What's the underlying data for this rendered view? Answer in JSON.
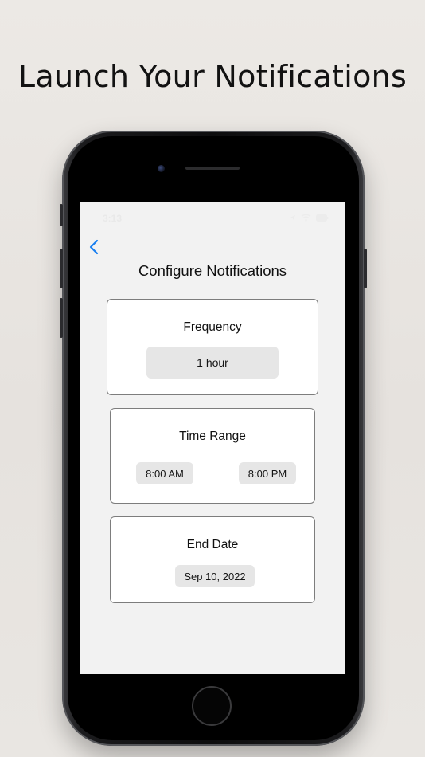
{
  "headline": "Launch Your Notifications",
  "status_bar": {
    "time": "3:13"
  },
  "nav": {
    "back_icon": "chevron-left-icon",
    "title": "Configure Notifications"
  },
  "frequency": {
    "title": "Frequency",
    "value": "1 hour"
  },
  "time_range": {
    "title": "Time Range",
    "start": "8:00 AM",
    "end": "8:00 PM"
  },
  "end_date": {
    "title": "End Date",
    "value": "Sep 10, 2022"
  },
  "colors": {
    "accent": "#1a7ff0",
    "screen_background": "#f2f2f2",
    "card_border": "#7d7d7d",
    "pill_background": "#e6e6e6"
  }
}
